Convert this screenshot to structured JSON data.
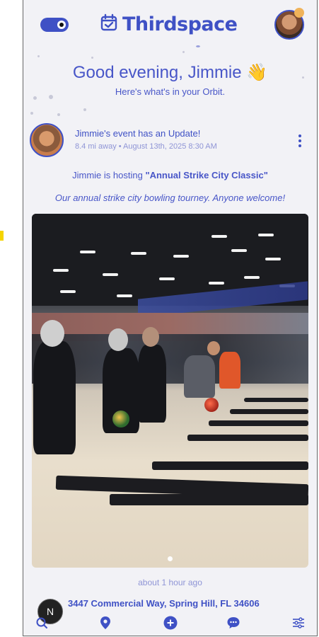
{
  "header": {
    "brand_name": "Thirdspace",
    "toggle_state": "on"
  },
  "greeting": {
    "title": "Good evening, Jimmie",
    "wave_emoji": "👋",
    "subtitle": "Here's what's in your Orbit."
  },
  "post": {
    "title": "Jimmie's event has an Update!",
    "meta": "8.4 mi away • August 13th, 2025 8:30 AM",
    "hosting_prefix": "Jimmie is hosting",
    "event_name": "\"Annual Strike City Classic\"",
    "description": "Our annual strike city bowling tourney. Anyone welcome!",
    "time_ago": "about 1 hour ago",
    "address": "3447 Commercial Way, Spring Hill, FL 34606"
  },
  "floating_badge": {
    "letter": "N"
  },
  "icons": {
    "calendar": "calendar-check-icon",
    "menu": "more-vertical-icon",
    "nav": [
      "search-icon",
      "location-pin-icon",
      "add-icon",
      "chat-icon",
      "filter-icon"
    ]
  },
  "colors": {
    "accent": "#3f51c5",
    "muted": "#8f95d6",
    "background": "#f2f2f6"
  }
}
